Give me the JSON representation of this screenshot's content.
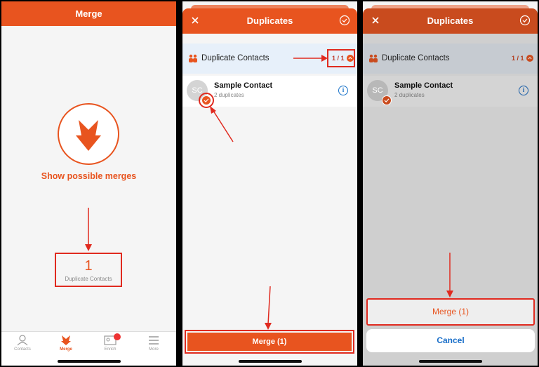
{
  "colors": {
    "accent": "#e8541f",
    "highlight": "#e02a1f",
    "link": "#1a73c9"
  },
  "panel1": {
    "header_title": "Merge",
    "show_merges_label": "Show possible merges",
    "duplicate_count": "1",
    "duplicate_count_label": "Duplicate Contacts",
    "tabs": [
      {
        "label": "Contacts",
        "icon": "person-icon"
      },
      {
        "label": "Merge",
        "icon": "merge-icon"
      },
      {
        "label": "Enrich",
        "icon": "card-icon"
      },
      {
        "label": "More",
        "icon": "menu-icon"
      }
    ]
  },
  "panel2": {
    "title": "Duplicates",
    "section_label": "Duplicate Contacts",
    "section_count": "1 / 1",
    "contact": {
      "initials": "SC",
      "name": "Sample Contact",
      "subtitle": "2 duplicates"
    },
    "merge_button": "Merge (1)"
  },
  "panel3": {
    "title": "Duplicates",
    "section_label": "Duplicate Contacts",
    "section_count": "1 / 1",
    "contact": {
      "initials": "SC",
      "name": "Sample Contact",
      "subtitle": "2 duplicates"
    },
    "action_merge": "Merge (1)",
    "cancel": "Cancel"
  }
}
